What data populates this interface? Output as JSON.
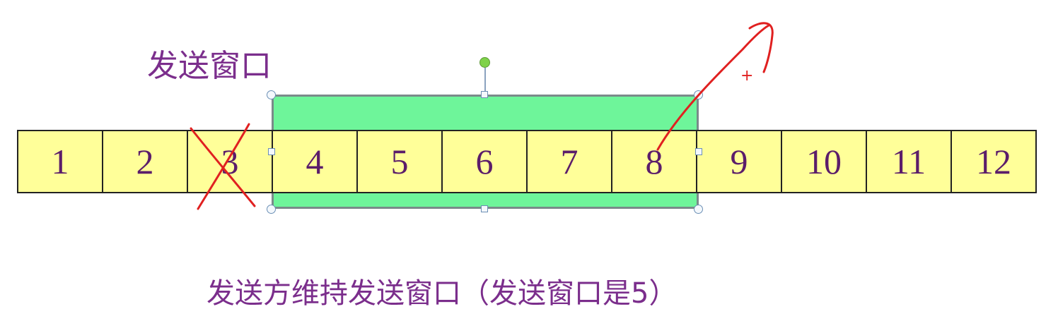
{
  "title": "发送窗口",
  "caption": "发送方维持发送窗口（发送窗口是5）",
  "frames": [
    "1",
    "2",
    "3",
    "4",
    "5",
    "6",
    "7",
    "8",
    "9",
    "10",
    "11",
    "12"
  ],
  "window": {
    "start_frame": "4",
    "end_frame": "8"
  },
  "colors": {
    "frame_fill": "#ffff99",
    "window_fill": "#6ef59a",
    "text": "#7b2e8c",
    "annotation": "#e02020"
  },
  "annotations": {
    "crossed_out_frame": "3",
    "plus_mark": "+"
  }
}
